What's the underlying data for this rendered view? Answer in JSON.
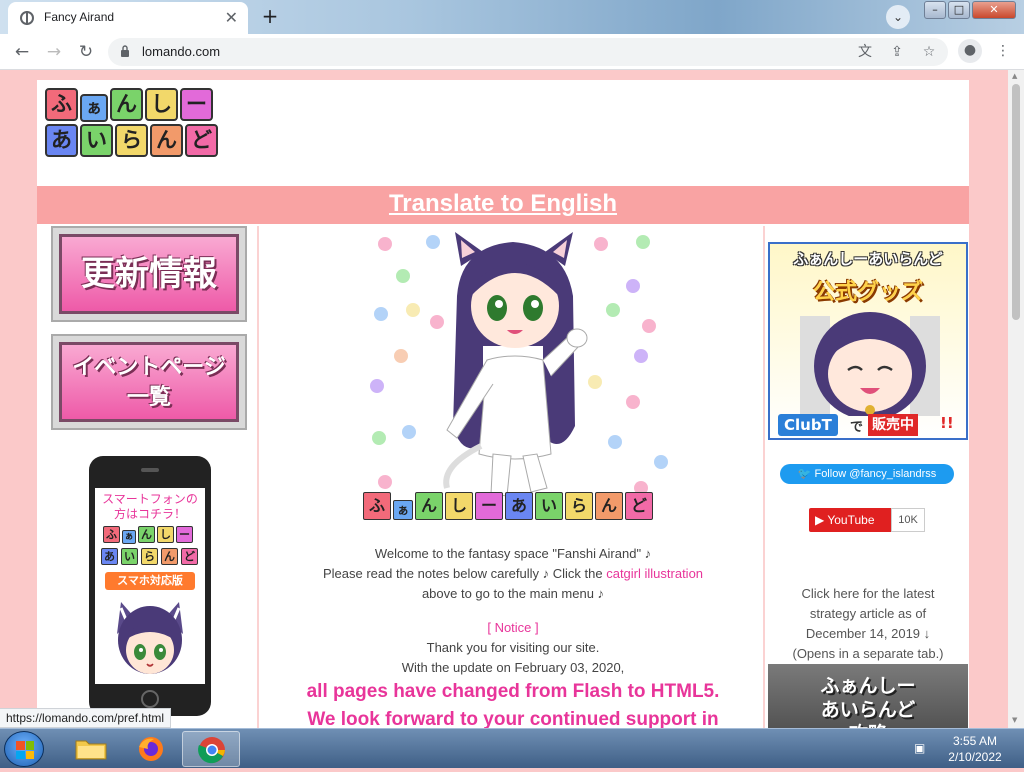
{
  "browser": {
    "tab_title": "Fancy Airand",
    "new_tab": "+",
    "close_tab": "✕",
    "url": "lomando.com",
    "window": {
      "minimize": "–",
      "maximize": "□",
      "close": "✕"
    }
  },
  "site": {
    "logo_row1": [
      "ふ",
      "ぁ",
      "ん",
      "し",
      "ー"
    ],
    "logo_row2": [
      "あ",
      "い",
      "ら",
      "ん",
      "ど"
    ],
    "translate_link": "Translate to English",
    "left": {
      "update_button": "更新情報",
      "event_button_line1": "イベントページ",
      "event_button_line2": "一覧",
      "phone_msg_line1": "スマートフォンの",
      "phone_msg_line2": "方はコチラ！",
      "phone_logo_row1": [
        "ふ",
        "ぁ",
        "ん",
        "し",
        "ー"
      ],
      "phone_logo_row2": [
        "あ",
        "い",
        "ら",
        "ん",
        "ど"
      ],
      "phone_tag": "スマホ対応版"
    },
    "center": {
      "banner_tiles": [
        "ふ",
        "ぁ",
        "ん",
        "し",
        "ー",
        "あ",
        "い",
        "ら",
        "ん",
        "ど"
      ],
      "welcome_line1": "Welcome to the fantasy space \"Fanshi Airand\" ♪",
      "welcome_line2_pre": "Please read the notes below carefully ♪ Click the ",
      "welcome_link": "catgirl illustration",
      "welcome_line3": "above to go to the main menu ♪",
      "notice_open": "[ ",
      "notice_link": "Notice",
      "notice_close": " ]",
      "thanks": "Thank you for visiting our site.",
      "update_line": "With the update on February 03, 2020,",
      "big_line1": "all pages have changed from Flash to HTML5.",
      "big_line2": "We look forward to your continued support in"
    },
    "right": {
      "goods_title": "ふぁんしーあいらんど",
      "goods_subtitle": "公式グッズ",
      "goods_club": "ClubT",
      "goods_de": "で",
      "goods_hanbai": "販売中",
      "goods_excl": "!!",
      "twitter": "Follow @fancy_islandrss",
      "youtube": "YouTube",
      "youtube_count": "10K",
      "strategy_line1": "Click here for the latest",
      "strategy_line2": "strategy article as of",
      "strategy_line3": "December 14, 2019 ↓",
      "strategy_line4": "(Opens in a separate tab.)",
      "strategy_img_line1": "ふぁんしー",
      "strategy_img_line2": "あいらんど",
      "strategy_img_line3": "攻略"
    }
  },
  "status_url": "https://lomando.com/pref.html",
  "taskbar": {
    "time": "3:55 AM",
    "date": "2/10/2022"
  },
  "colors": {
    "pink_bg": "#fbc9c9",
    "accent": "#e8359a",
    "translate_bar": "#f9a3a3"
  }
}
